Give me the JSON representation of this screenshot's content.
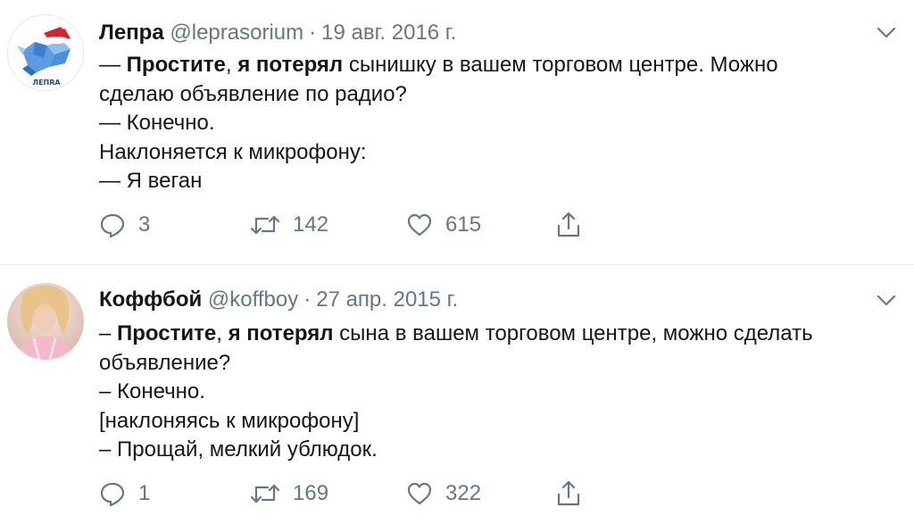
{
  "tweets": [
    {
      "name": "Лепра",
      "handle": "@leprasorium",
      "separator": "·",
      "date": "19 авг. 2016 г.",
      "avatar_text": "ЛЕПRA",
      "lines": [
        [
          {
            "t": "— ",
            "b": false
          },
          {
            "t": "Простите",
            "b": true
          },
          {
            "t": ", ",
            "b": false
          },
          {
            "t": "я потерял",
            "b": true
          },
          {
            "t": " сынишку в вашем торговом центре. Можно",
            "b": false
          }
        ],
        [
          {
            "t": "сделаю объявление по радио?",
            "b": false
          }
        ],
        [
          {
            "t": "— Конечно.",
            "b": false
          }
        ],
        [
          {
            "t": "Наклоняется к микрофону:",
            "b": false
          }
        ],
        [
          {
            "t": "— Я веган",
            "b": false
          }
        ]
      ],
      "replies": "3",
      "retweets": "142",
      "likes": "615",
      "icons": {
        "reply": "reply-icon",
        "retweet": "retweet-icon",
        "like": "heart-icon",
        "share": "share-icon",
        "menu": "chevron-down-icon"
      }
    },
    {
      "name": "Коффбой",
      "handle": "@koffboy",
      "separator": "·",
      "date": "27 апр. 2015 г.",
      "lines": [
        [
          {
            "t": "– ",
            "b": false
          },
          {
            "t": "Простите",
            "b": true
          },
          {
            "t": ", ",
            "b": false
          },
          {
            "t": "я потерял",
            "b": true
          },
          {
            "t": " сына в вашем торговом центре, можно сделать",
            "b": false
          }
        ],
        [
          {
            "t": "объявление?",
            "b": false
          }
        ],
        [
          {
            "t": "– Конечно.",
            "b": false
          }
        ],
        [
          {
            "t": "[наклоняясь к микрофону]",
            "b": false
          }
        ],
        [
          {
            "t": "– Прощай, мелкий ублюдок.",
            "b": false
          }
        ]
      ],
      "replies": "1",
      "retweets": "169",
      "likes": "322",
      "icons": {
        "reply": "reply-icon",
        "retweet": "retweet-icon",
        "like": "heart-icon",
        "share": "share-icon",
        "menu": "chevron-down-icon"
      }
    }
  ],
  "colors": {
    "text": "#14171a",
    "secondary": "#657786",
    "divider": "#e6ecf0",
    "logo_blue": "#4a8fd9",
    "santa_red": "#d8232a"
  }
}
